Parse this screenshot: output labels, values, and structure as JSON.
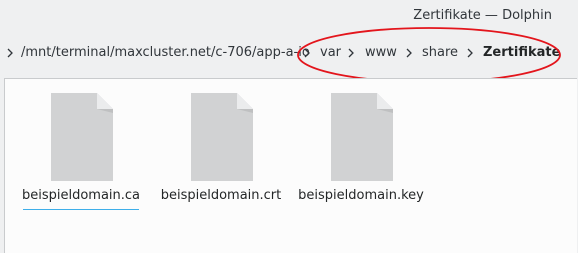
{
  "window": {
    "title": "Zertifikate — Dolphin"
  },
  "breadcrumb": {
    "items": [
      {
        "label": "/mnt/terminal/maxcluster.net/c-706/app-a-io"
      },
      {
        "label": "var"
      },
      {
        "label": "www"
      },
      {
        "label": "share"
      },
      {
        "label": "Zertifikate"
      }
    ]
  },
  "files": [
    {
      "name": "beispieldomain.ca",
      "icon": "document-icon"
    },
    {
      "name": "beispieldomain.crt",
      "icon": "document-icon"
    },
    {
      "name": "beispieldomain.key",
      "icon": "document-icon"
    }
  ],
  "colors": {
    "highlight": "#e3151c",
    "selection_underline": "#3daee9"
  }
}
